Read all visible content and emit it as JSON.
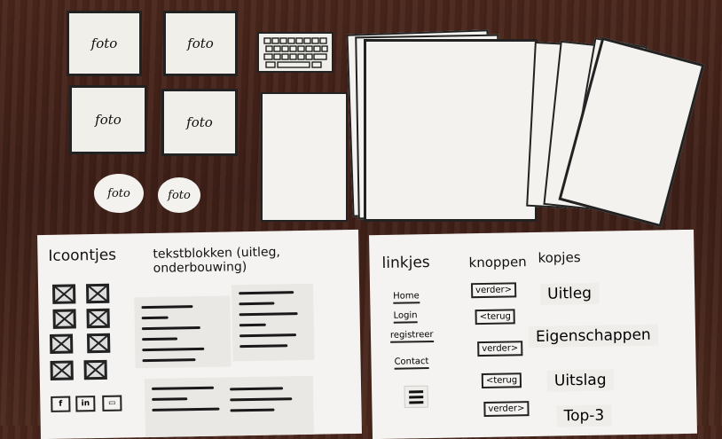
{
  "photo_cards": {
    "label": "foto"
  },
  "left_sheet": {
    "heading_icons": "Icoontjes",
    "heading_text_blocks": "tekstblokken (uitleg, onderbouwing)",
    "social_icons": [
      "f",
      "in",
      "▭"
    ]
  },
  "right_sheet": {
    "heading_links": "linkjes",
    "heading_buttons": "knoppen",
    "heading_titles": "kopjes",
    "links": [
      "Home",
      "Login",
      "registreer",
      "Contact"
    ],
    "buttons": [
      "verder>",
      "<terug",
      "verder>",
      "<terug",
      "verder>"
    ],
    "titles": [
      "Uitleg",
      "Eigenschappen",
      "Uitslag",
      "Top-3"
    ]
  }
}
